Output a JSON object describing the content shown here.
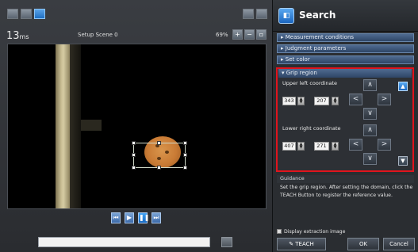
{
  "toolbar": {
    "icons": [
      "panel-icon",
      "panel-icon",
      "scene-icon"
    ]
  },
  "status": {
    "time_value": "13",
    "time_unit": "ms",
    "scene_label": "Setup Scene 0",
    "zoom_level": "69%"
  },
  "right_panel": {
    "title": "Search",
    "sections": [
      {
        "label": "Measurement conditions",
        "expanded": false
      },
      {
        "label": "Judgment parameters",
        "expanded": false
      },
      {
        "label": "Set color",
        "expanded": false
      }
    ],
    "grip_region": {
      "header": "Grip region",
      "upper_left_label": "Upper left coordinate",
      "upper_left_x": "343",
      "upper_left_y": "207",
      "lower_right_label": "Lower right coordinate",
      "lower_right_x": "407",
      "lower_right_y": "271"
    },
    "guidance": {
      "header": "Guidance",
      "text": "Set the grip region. After setting the domain, click the TEACH Button to register the reference value."
    },
    "display_extraction_label": "Display extraction image",
    "buttons": {
      "teach": "TEACH",
      "ok": "OK",
      "cancel": "Cancel"
    }
  },
  "colors": {
    "highlight_border": "#e0141d",
    "accent_blue": "#1f6fc2"
  }
}
